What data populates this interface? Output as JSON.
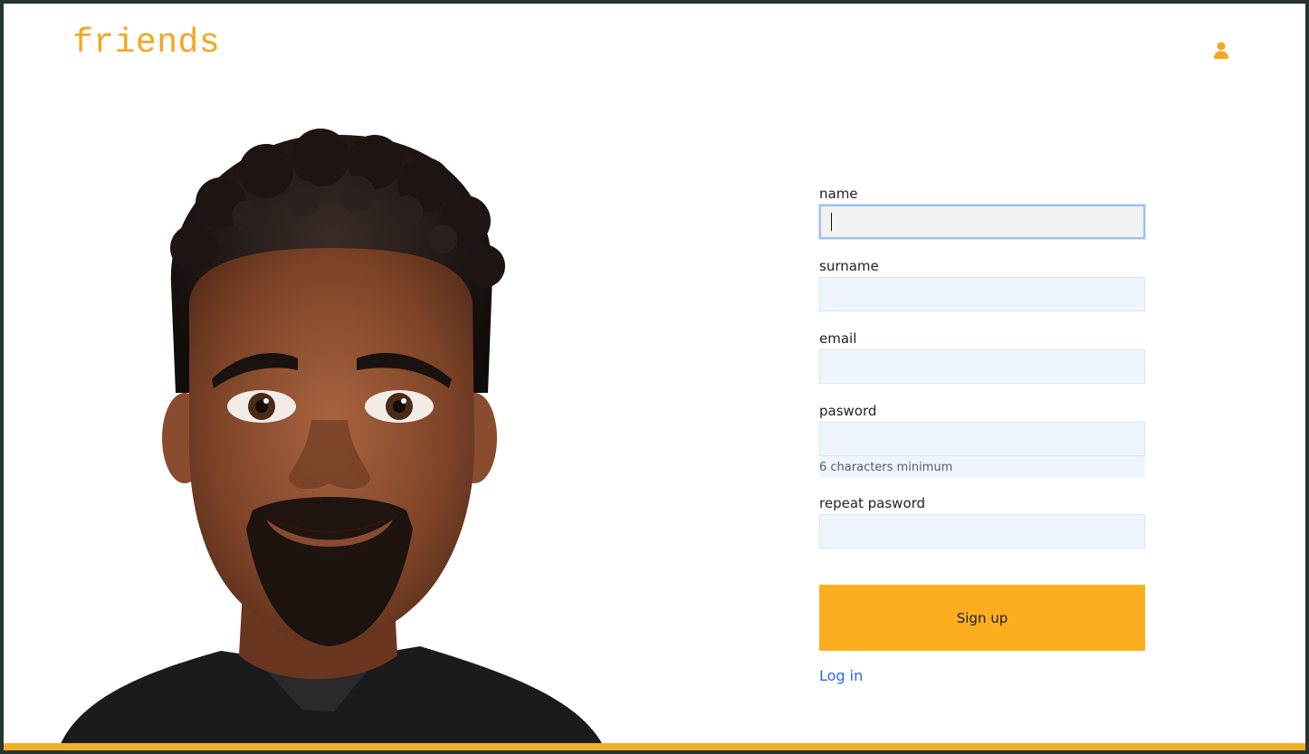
{
  "brand": {
    "logo": "friends",
    "accent_color": "#f5a524"
  },
  "header": {
    "user_icon": "user-icon"
  },
  "form": {
    "name_label": "name",
    "surname_label": "surname",
    "email_label": "email",
    "password_label": "pasword",
    "password_hint": "6 characters minimum",
    "repeat_password_label": "repeat pasword",
    "name_value": "",
    "surname_value": "",
    "email_value": "",
    "password_value": "",
    "repeat_password_value": "",
    "signup_label": "Sign up",
    "login_label": "Log in"
  },
  "colors": {
    "button": "#fdae1e",
    "link": "#2b6ad4",
    "bottom_bar": "#f1b02a"
  }
}
